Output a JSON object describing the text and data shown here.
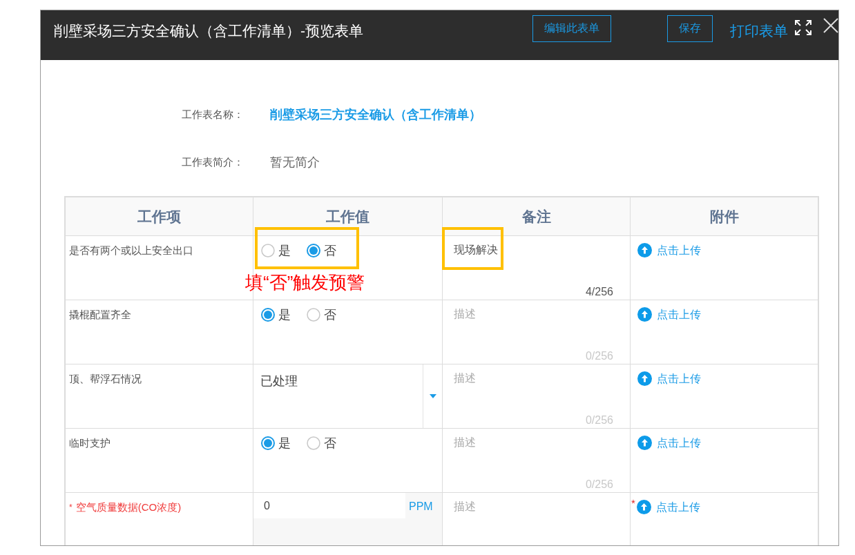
{
  "dialog": {
    "title": "削壁采场三方安全确认（含工作清单）-预览表单",
    "actions": [
      {
        "label": "编辑此表单",
        "kind": "outline"
      },
      {
        "label": "保存",
        "kind": "outline"
      },
      {
        "label": "打印表单",
        "kind": "link"
      }
    ]
  },
  "info": [
    {
      "label": "工作表名称：",
      "value": "削壁采场三方安全确认（含工作清单）",
      "kind": "title"
    },
    {
      "label": "工作表简介：",
      "value": "暂无简介",
      "kind": "plain"
    }
  ],
  "table": {
    "columns": [
      "工作项",
      "工作值",
      "备注",
      "附件"
    ],
    "rows": [
      {
        "item": {
          "label": "是否有两个或以上安全出口",
          "required": false
        },
        "value": {
          "kind": "radio",
          "highlighted": true,
          "options": [
            {
              "label": "是",
              "selected": false
            },
            {
              "label": "否",
              "selected": true
            }
          ]
        },
        "note": "填“否”触发预警",
        "remark": {
          "value": "现场解决",
          "counter": "4/256",
          "highlighted": true
        },
        "attachment": {
          "label": "点击上传"
        }
      },
      {
        "item": {
          "label": "撬棍配置齐全",
          "required": false
        },
        "value": {
          "kind": "radio",
          "highlighted": false,
          "options": [
            {
              "label": "是",
              "selected": true
            },
            {
              "label": "否",
              "selected": false
            }
          ]
        },
        "remark": {
          "placeholder": "描述",
          "counter": "0/256",
          "highlighted": false
        },
        "attachment": {
          "label": "点击上传"
        }
      },
      {
        "item": {
          "label": "顶、帮浮石情况",
          "required": false
        },
        "value": {
          "kind": "select",
          "highlighted": false,
          "text": "已处理"
        },
        "remark": {
          "placeholder": "描述",
          "counter": "0/256",
          "highlighted": false
        },
        "attachment": {
          "label": "点击上传"
        }
      },
      {
        "item": {
          "label": "临时支护",
          "required": false
        },
        "value": {
          "kind": "radio",
          "highlighted": false,
          "options": [
            {
              "label": "是",
              "selected": true
            },
            {
              "label": "否",
              "selected": false
            }
          ]
        },
        "remark": {
          "placeholder": "描述",
          "counter": "0/256",
          "highlighted": false
        },
        "attachment": {
          "label": "点击上传"
        }
      },
      {
        "item": {
          "label": "空气质量数据(CO浓度)",
          "required": true,
          "mark": "*"
        },
        "value": {
          "kind": "number",
          "highlighted": false,
          "text": "0",
          "unit": "PPM"
        },
        "remark": {
          "placeholder": "描述",
          "highlighted": false
        },
        "attachment": {
          "label": "点击上传",
          "mark": "*"
        }
      }
    ]
  }
}
